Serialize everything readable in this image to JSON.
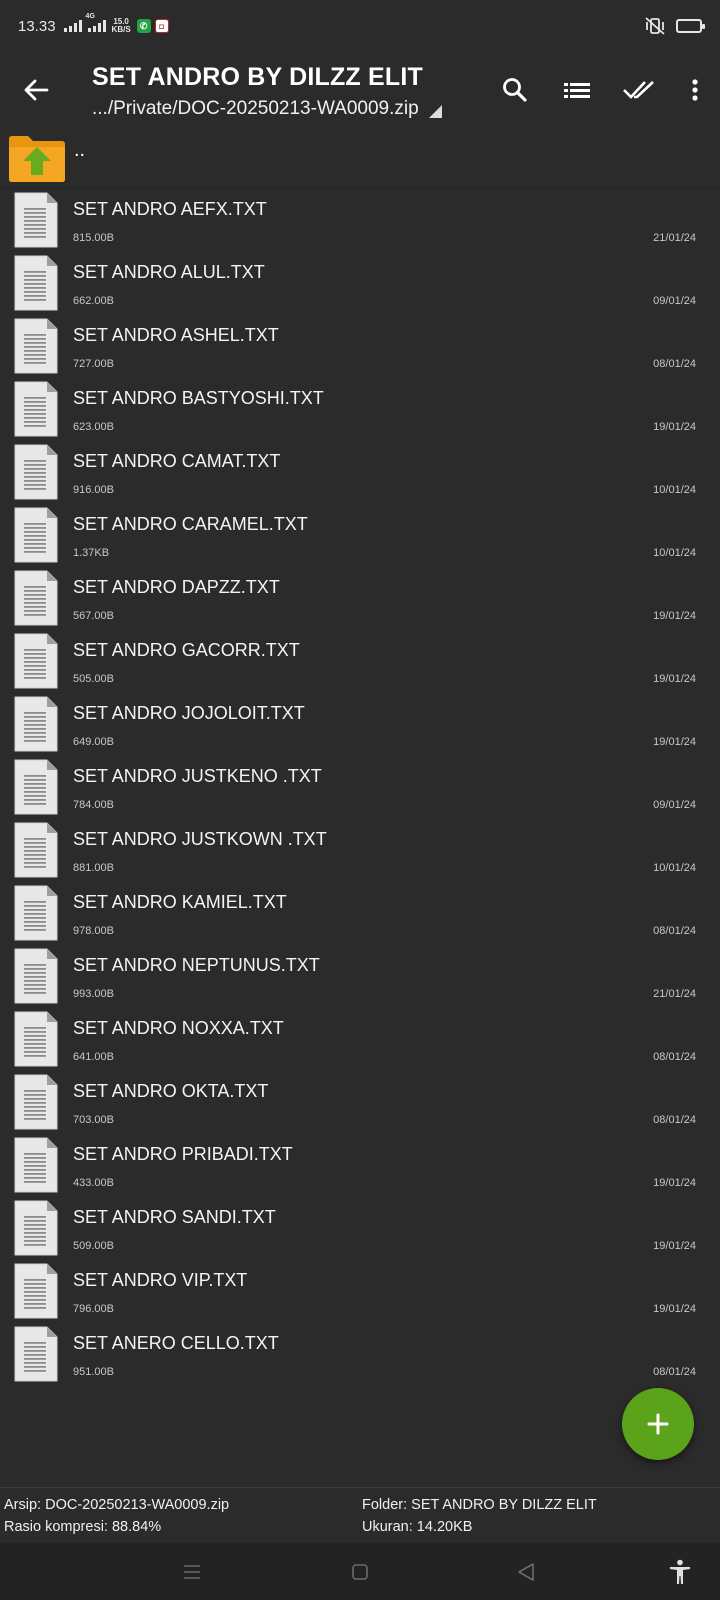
{
  "status": {
    "time": "13.33",
    "net_speed_value": "15.0",
    "net_speed_unit": "KB/S",
    "signal_label": "4G",
    "vibrate_icon": "vibrate-icon",
    "battery_color": "#f2c500"
  },
  "toolbar": {
    "title": "SET ANDRO BY DILZZ ELIT",
    "path": ".../Private/DOC-20250213-WA0009.zip",
    "back_icon": "arrow-left-icon",
    "search_icon": "search-icon",
    "list_icon": "list-view-icon",
    "select_icon": "double-check-icon",
    "more_icon": "more-vert-icon"
  },
  "list": {
    "parent_label": "..",
    "files": [
      {
        "name": "SET ANDRO AEFX.TXT",
        "size": "815.00B",
        "date": "21/01/24"
      },
      {
        "name": "SET ANDRO ALUL.TXT",
        "size": "662.00B",
        "date": "09/01/24"
      },
      {
        "name": "SET ANDRO ASHEL.TXT",
        "size": "727.00B",
        "date": "08/01/24"
      },
      {
        "name": "SET ANDRO BASTYOSHI.TXT",
        "size": "623.00B",
        "date": "19/01/24"
      },
      {
        "name": "SET ANDRO CAMAT.TXT",
        "size": "916.00B",
        "date": "10/01/24"
      },
      {
        "name": "SET ANDRO CARAMEL.TXT",
        "size": "1.37KB",
        "date": "10/01/24"
      },
      {
        "name": "SET ANDRO DAPZZ.TXT",
        "size": "567.00B",
        "date": "19/01/24"
      },
      {
        "name": "SET ANDRO GACORR.TXT",
        "size": "505.00B",
        "date": "19/01/24"
      },
      {
        "name": "SET ANDRO JOJOLOIT.TXT",
        "size": "649.00B",
        "date": "19/01/24"
      },
      {
        "name": "SET ANDRO JUSTKENO .TXT",
        "size": "784.00B",
        "date": "09/01/24"
      },
      {
        "name": "SET ANDRO JUSTKOWN .TXT",
        "size": "881.00B",
        "date": "10/01/24"
      },
      {
        "name": "SET ANDRO KAMIEL.TXT",
        "size": "978.00B",
        "date": "08/01/24"
      },
      {
        "name": "SET ANDRO NEPTUNUS.TXT",
        "size": "993.00B",
        "date": "21/01/24"
      },
      {
        "name": "SET ANDRO NOXXA.TXT",
        "size": "641.00B",
        "date": "08/01/24"
      },
      {
        "name": "SET ANDRO OKTA.TXT",
        "size": "703.00B",
        "date": "08/01/24"
      },
      {
        "name": "SET ANDRO PRIBADI.TXT",
        "size": "433.00B",
        "date": "19/01/24"
      },
      {
        "name": "SET ANDRO SANDI.TXT",
        "size": "509.00B",
        "date": "19/01/24"
      },
      {
        "name": "SET ANDRO VIP.TXT",
        "size": "796.00B",
        "date": "19/01/24"
      },
      {
        "name": "SET ANERO CELLO.TXT",
        "size": "951.00B",
        "date": "08/01/24"
      }
    ]
  },
  "fab": {
    "icon": "plus-icon",
    "color": "#5aa31a"
  },
  "info": {
    "archive": "Arsip: DOC-20250213-WA0009.zip",
    "ratio": "Rasio kompresi: 88.84%",
    "folder": "Folder: SET ANDRO BY DILZZ ELIT",
    "size": "Ukuran: 14.20KB"
  },
  "nav": {
    "menu_icon": "recents-icon",
    "home_icon": "home-icon",
    "back_icon": "back-triangle-icon",
    "accessibility_icon": "accessibility-icon"
  }
}
